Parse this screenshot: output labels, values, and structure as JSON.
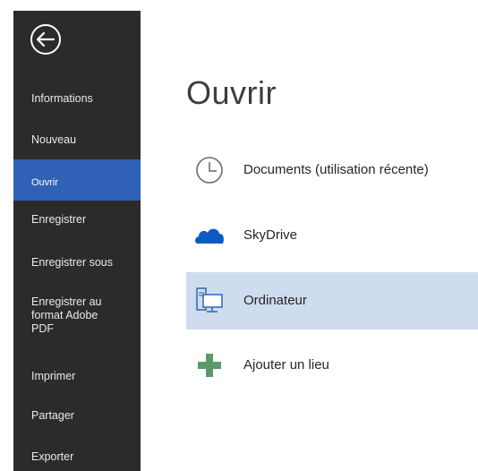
{
  "sidebar": {
    "back_icon": "back-arrow-circle-icon",
    "items": [
      {
        "label": "Informations"
      },
      {
        "label": "Nouveau"
      },
      {
        "label": "Ouvrir",
        "active": true
      },
      {
        "label": "Enregistrer"
      },
      {
        "label": "Enregistrer sous"
      },
      {
        "label": "Enregistrer au format Adobe PDF"
      },
      {
        "label": "Imprimer"
      },
      {
        "label": "Partager"
      },
      {
        "label": "Exporter"
      }
    ],
    "bg_color": "#2b2b2b",
    "active_color": "#2f62b7"
  },
  "main": {
    "title": "Ouvrir",
    "places": [
      {
        "label": "Documents (utilisation récente)",
        "icon": "clock-icon"
      },
      {
        "label": "SkyDrive",
        "icon": "cloud-icon"
      },
      {
        "label": "Ordinateur",
        "icon": "computer-icon",
        "selected": true
      },
      {
        "label": "Ajouter un lieu",
        "icon": "plus-icon"
      }
    ],
    "selected_color": "#cfdcf0"
  }
}
